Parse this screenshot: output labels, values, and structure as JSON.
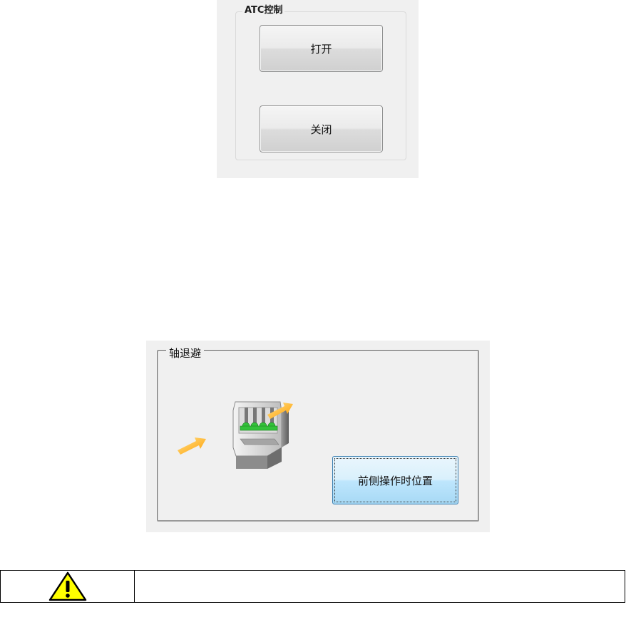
{
  "atc_control": {
    "group_title": "ATC控制",
    "open_button": "打开",
    "close_button": "关闭"
  },
  "axis_retreat": {
    "group_title": "轴退避",
    "machine_icon": "machine-tool-icon",
    "front_position_button": "前侧操作时位置"
  },
  "warning": {
    "icon": "warning-triangle-icon",
    "text": ""
  },
  "colors": {
    "panel_bg": "#f0f0f0",
    "active_button": "#bee6fd",
    "arrow": "#ffb300",
    "warning_yellow": "#ffff00"
  }
}
